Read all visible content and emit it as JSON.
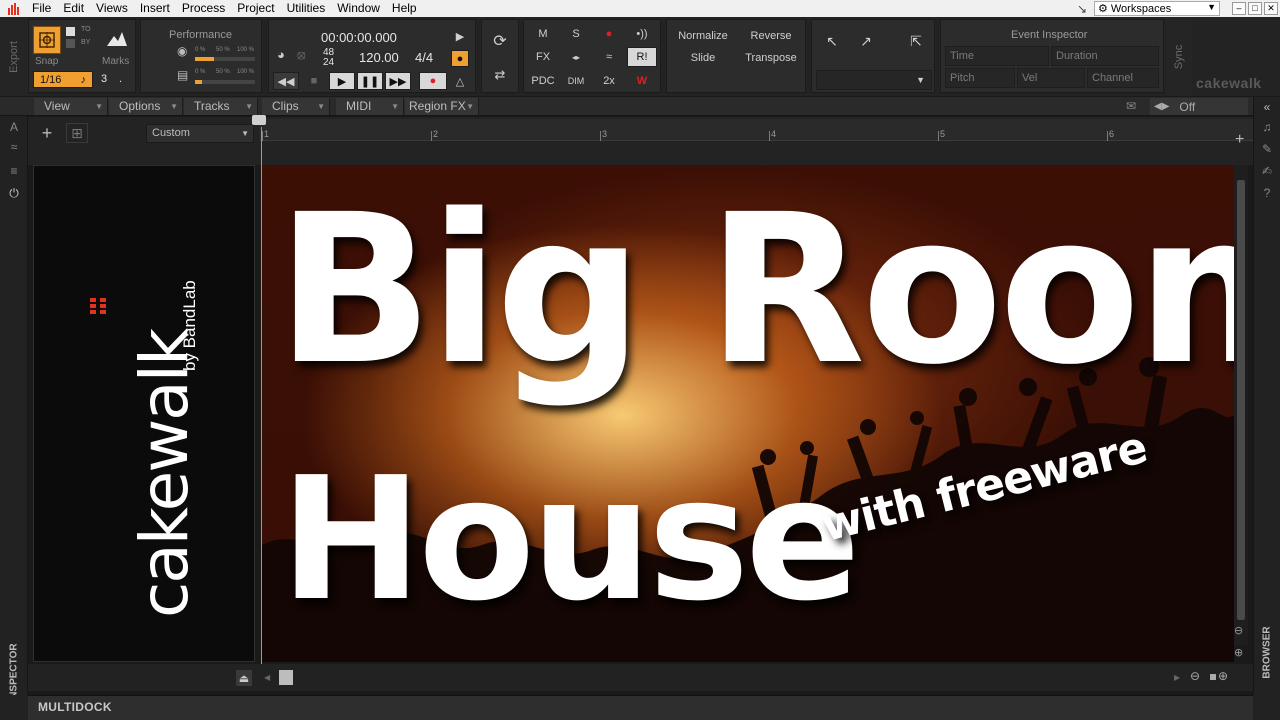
{
  "menubar": {
    "items": [
      "File",
      "Edit",
      "Views",
      "Insert",
      "Process",
      "Project",
      "Utilities",
      "Window",
      "Help"
    ],
    "workspaces_label": "Workspaces"
  },
  "controlbar": {
    "export_label": "Export",
    "snap": {
      "label": "Snap",
      "value": "1/16",
      "to_label": "TO",
      "by_label": "BY"
    },
    "marks": {
      "label": "Marks",
      "value": "3"
    },
    "performance": {
      "label": "Performance",
      "pct0": "0 %",
      "pct50": "50 %",
      "pct100": "100 %",
      "cpu_level": 0.32,
      "disk_level": 0.12
    },
    "transport": {
      "time": "00:00:00.000",
      "sample_rate_top": "48",
      "sample_rate_bottom": "24",
      "tempo": "120.00",
      "meter": "4/4"
    },
    "mix": {
      "m": "M",
      "s": "S",
      "fx": "FX",
      "pdc": "PDC",
      "dim": "DIM",
      "x2": "2x",
      "r": "R!"
    },
    "edit": {
      "normalize": "Normalize",
      "reverse": "Reverse",
      "slide": "Slide",
      "transpose": "Transpose"
    },
    "event_inspector": {
      "title": "Event Inspector",
      "time": "Time",
      "duration": "Duration",
      "pitch": "Pitch",
      "vel": "Vel",
      "channel": "Channel"
    },
    "sync_label": "Sync",
    "brand": "cakewalk"
  },
  "trackview": {
    "menus": [
      "View",
      "Options",
      "Tracks",
      "Clips",
      "MIDI",
      "Region FX"
    ],
    "off_label": "Off",
    "custom_label": "Custom",
    "ruler_marks": [
      "1",
      "2",
      "3",
      "4",
      "5",
      "6"
    ]
  },
  "thumbnail": {
    "line1": "Big Room",
    "line2": "House",
    "tagline": "with freeware",
    "logo_main": "cakewalk",
    "logo_sub": "by BandLab"
  },
  "side_labels": {
    "inspector": "INSPECTOR",
    "browser": "BROWSER"
  },
  "multidock": "MULTIDOCK",
  "colors": {
    "accent": "#f0a030",
    "record": "#e02020",
    "logo_red": "#e53020"
  }
}
